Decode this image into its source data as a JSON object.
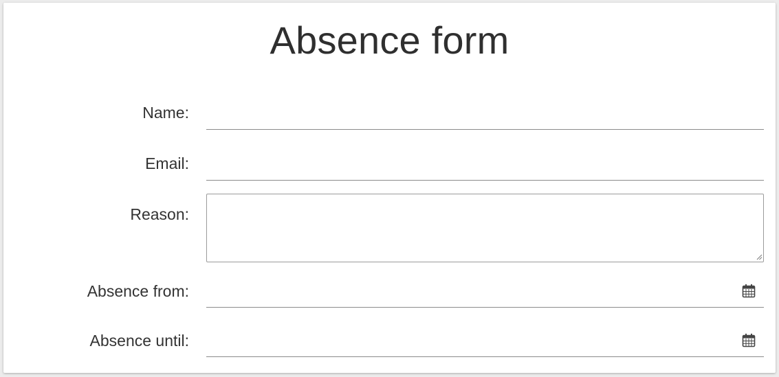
{
  "form": {
    "title": "Absence form",
    "fields": {
      "name": {
        "label": "Name:",
        "value": ""
      },
      "email": {
        "label": "Email:",
        "value": ""
      },
      "reason": {
        "label": "Reason:",
        "value": ""
      },
      "absence_from": {
        "label": "Absence from:",
        "value": "",
        "icon": "calendar-icon"
      },
      "absence_until": {
        "label": "Absence until:",
        "value": "",
        "icon": "calendar-icon"
      }
    }
  }
}
